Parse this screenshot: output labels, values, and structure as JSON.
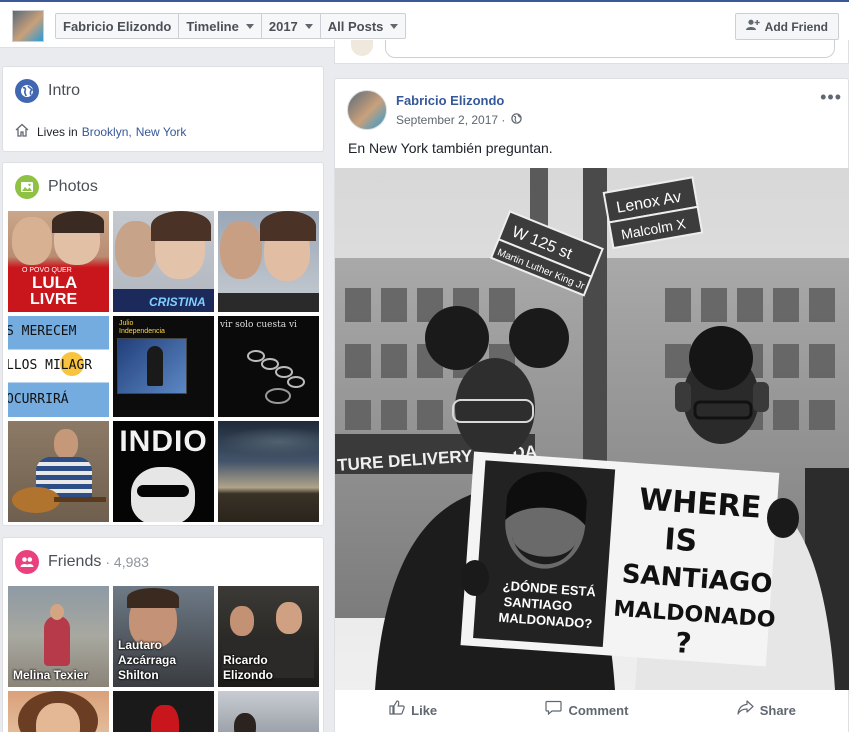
{
  "topbar": {
    "profile_name": "Fabricio Elizondo",
    "crumbs": [
      "Timeline",
      "2017",
      "All Posts"
    ],
    "add_friend": "Add Friend"
  },
  "intro": {
    "title": "Intro",
    "lives_prefix": "Lives in",
    "city": "Brooklyn,",
    "state": "New York"
  },
  "photos": {
    "title": "Photos",
    "tiles": [
      {
        "caption_1": "O POVO QUER",
        "caption_2": "LULA",
        "caption_3": "LIVRE"
      },
      {
        "caption": "CRISTINA"
      },
      {
        "caption": ""
      },
      {
        "lines": [
          "S MERECEM",
          "LLOS MILAGR",
          "OCURRIRÁ"
        ]
      },
      {
        "caption": "Julio\nIndependencia"
      },
      {
        "caption": "vir solo cuesta vi"
      },
      {
        "caption": ""
      },
      {
        "caption": "INDIO"
      },
      {
        "caption": ""
      }
    ]
  },
  "friends": {
    "title": "Friends",
    "count": "· 4,983",
    "items": [
      {
        "name": "Melina Texier"
      },
      {
        "name": "Lautaro Azcárraga Shilton"
      },
      {
        "name": "Ricardo Elizondo"
      }
    ]
  },
  "post": {
    "author": "Fabricio Elizondo",
    "date": "September 2, 2017 ·",
    "more": "•••",
    "text": "En New York también preguntan.",
    "photo": {
      "sign_lenox": "Lenox Av",
      "sign_malcolm": "Malcolm X",
      "sign_125": "W 125 st",
      "sign_mlk": "Martin Luther King Jr",
      "banner": "TURE DELIVERY IN 3 DA",
      "poster_spanish": "¿DÓNDE ESTÁ SANTIAGO MALDONADO?",
      "poster_1": "WHERE",
      "poster_2": "IS",
      "poster_3": "SANTiAGO",
      "poster_4": "MALDONADO",
      "poster_5": "?"
    },
    "actions": {
      "like": "Like",
      "comment": "Comment",
      "share": "Share"
    }
  }
}
